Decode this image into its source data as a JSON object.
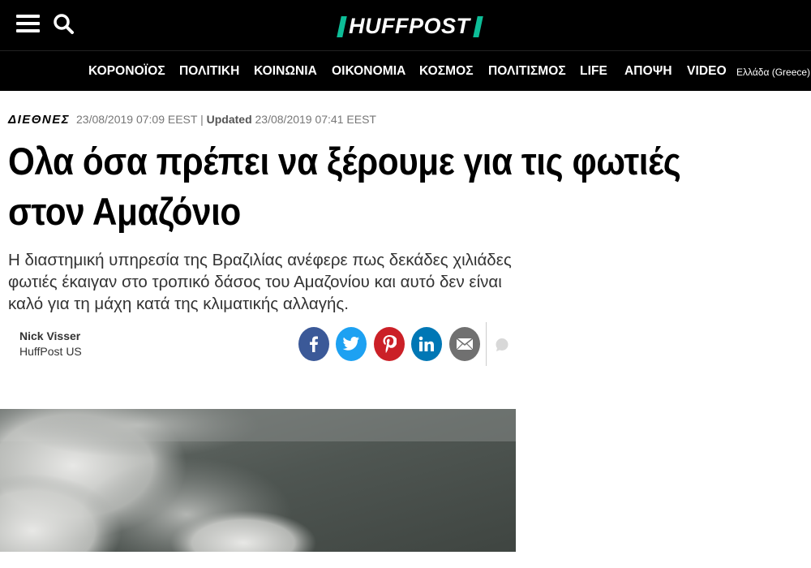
{
  "header": {
    "logo_text": "HUFFPOST",
    "brand_color": "#0dbe98",
    "menu_icon": "hamburger-menu-icon",
    "search_icon": "search-icon"
  },
  "nav": {
    "items": [
      "ΚΟΡΟΝΟΪΟΣ",
      "ΠΟΛΙΤΙΚΗ",
      "ΚΟΙΝΩΝΙΑ",
      "ΟΙΚΟΝΟΜΙΑ",
      "ΚΟΣΜΟΣ",
      "ΠΟΛΙΤΙΣΜΟΣ",
      "LIFE",
      "ΑΠΟΨΗ",
      "VIDEO"
    ],
    "edition": "Ελλάδα (Greece)"
  },
  "article": {
    "section": "ΔΙΕΘΝΕΣ",
    "published": "23/08/2019 07:09 EEST",
    "separator": "|",
    "updated_label": "Updated",
    "updated": "23/08/2019 07:41 EEST",
    "headline": "Ολα όσα πρέπει να ξέρουμε για τις φωτιές στον Αμαζόνιο",
    "subhead": "Η διαστημική υπηρεσία της Βραζιλίας ανέφερε πως δεκάδες χιλιάδες φωτιές έκαιγαν στο τροπικό δάσος του Αμαζονίου και αυτό δεν είναι καλό για τη μάχη κατά της κλιματικής αλλαγής.",
    "author_name": "Nick Visser",
    "author_org": "HuffPost US"
  },
  "share": [
    {
      "icon": "facebook-icon",
      "color": "#3b5998"
    },
    {
      "icon": "twitter-icon",
      "color": "#1da1f2"
    },
    {
      "icon": "pinterest-icon",
      "color": "#cb2027"
    },
    {
      "icon": "linkedin-icon",
      "color": "#0077b5"
    },
    {
      "icon": "email-icon",
      "color": "#707070"
    }
  ],
  "comment_icon": "comment-icon"
}
